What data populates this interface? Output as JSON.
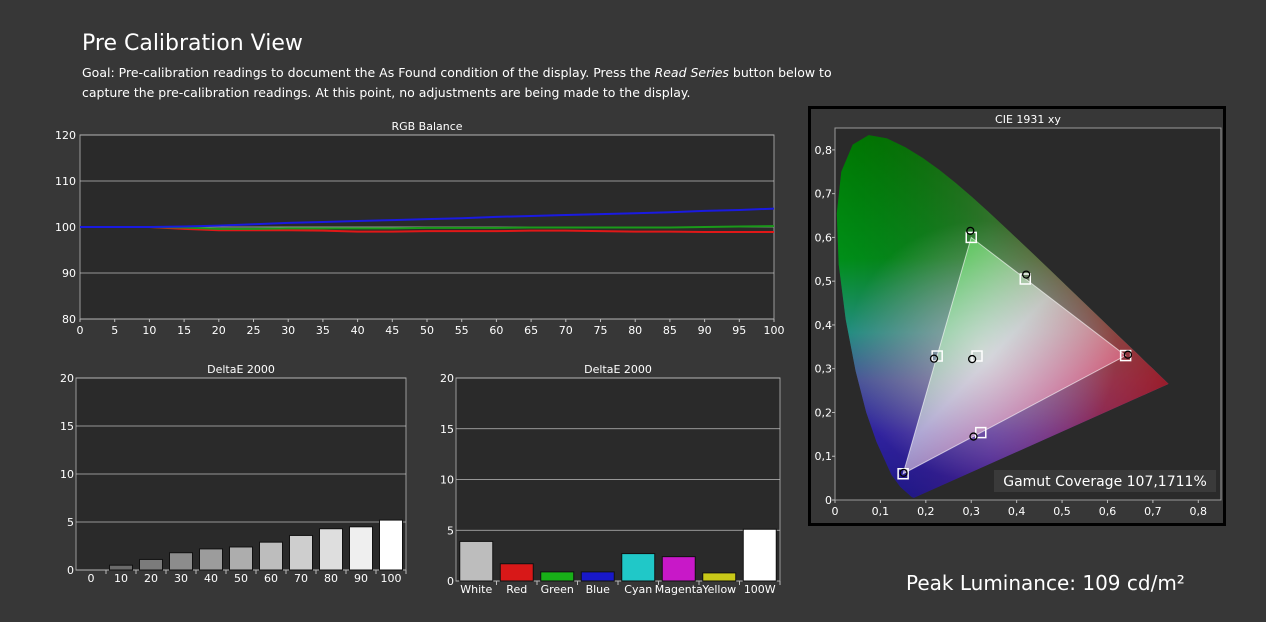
{
  "header": {
    "title": "Pre Calibration View",
    "goal_part1": "Goal: Pre-calibration readings to document the As Found condition of the display. Press the ",
    "goal_em": "Read Series",
    "goal_part2": " button below to capture the pre-calibration readings. At this point, no adjustments are being made to the display."
  },
  "peak_luminance": "Peak Luminance: 109 cd/m²",
  "colors": {
    "background": "#373737",
    "plot_bg": "#2a2a2a",
    "grid": "#bdbdbd",
    "red": "#e01818",
    "green": "#1a9a1a",
    "blue": "#1a1ae0"
  },
  "chart_data": [
    {
      "id": "rgb_balance",
      "type": "line",
      "title": "RGB Balance",
      "x": [
        0,
        5,
        10,
        15,
        20,
        25,
        30,
        35,
        40,
        45,
        50,
        55,
        60,
        65,
        70,
        75,
        80,
        85,
        90,
        95,
        100
      ],
      "x_ticks": [
        "0",
        "5",
        "10",
        "15",
        "20",
        "25",
        "30",
        "35",
        "40",
        "45",
        "50",
        "55",
        "60",
        "65",
        "70",
        "75",
        "80",
        "85",
        "90",
        "95",
        "100"
      ],
      "y_ticks": [
        "80",
        "90",
        "100",
        "110",
        "120"
      ],
      "ylim": [
        80,
        120
      ],
      "xlim": [
        0,
        100
      ],
      "grid": true,
      "series": [
        {
          "color": "#e01818",
          "values": [
            100,
            100,
            100,
            99.6,
            99.3,
            99.3,
            99.3,
            99.2,
            99.0,
            99.0,
            99.1,
            99.1,
            99.1,
            99.2,
            99.2,
            99.1,
            99.0,
            99.0,
            98.9,
            98.9,
            98.9
          ]
        },
        {
          "color": "#1a9a1a",
          "values": [
            100,
            100,
            100,
            99.9,
            99.6,
            99.6,
            99.7,
            99.7,
            99.7,
            99.7,
            99.8,
            99.8,
            99.8,
            99.9,
            99.9,
            99.9,
            99.9,
            99.9,
            100.0,
            100.1,
            100.2
          ]
        },
        {
          "color": "#1a1ae0",
          "values": [
            100,
            100,
            100,
            100.1,
            100.3,
            100.6,
            100.9,
            101.1,
            101.3,
            101.5,
            101.7,
            101.9,
            102.2,
            102.4,
            102.6,
            102.8,
            103.0,
            103.2,
            103.5,
            103.7,
            104.0
          ]
        }
      ]
    },
    {
      "id": "deltae_grayscale",
      "type": "bar",
      "title": "DeltaE 2000",
      "categories": [
        "0",
        "10",
        "20",
        "30",
        "40",
        "50",
        "60",
        "70",
        "80",
        "90",
        "100"
      ],
      "values": [
        0,
        0.5,
        1.1,
        1.8,
        2.2,
        2.4,
        2.9,
        3.6,
        4.3,
        4.5,
        5.2
      ],
      "y_ticks": [
        "0",
        "5",
        "10",
        "15",
        "20"
      ],
      "ylim": [
        0,
        20
      ],
      "grid": true
    },
    {
      "id": "deltae_colors",
      "type": "bar",
      "title": "DeltaE 2000",
      "categories": [
        "White",
        "Red",
        "Green",
        "Blue",
        "Cyan",
        "Magenta",
        "Yellow",
        "100W"
      ],
      "values": [
        3.9,
        1.7,
        0.9,
        0.9,
        2.7,
        2.4,
        0.8,
        5.1
      ],
      "bar_colors": [
        "#bdbdbd",
        "#d81818",
        "#18b018",
        "#1818c8",
        "#20c8c8",
        "#c818c8",
        "#c8c818",
        "#ffffff"
      ],
      "y_ticks": [
        "0",
        "5",
        "10",
        "15",
        "20"
      ],
      "ylim": [
        0,
        20
      ],
      "grid": true
    },
    {
      "id": "cie_1931",
      "type": "scatter",
      "title": "CIE 1931 xy",
      "x_ticks": [
        "0",
        "0,1",
        "0,2",
        "0,3",
        "0,4",
        "0,5",
        "0,6",
        "0,7",
        "0,8"
      ],
      "y_ticks": [
        "0",
        "0,1",
        "0,2",
        "0,3",
        "0,4",
        "0,5",
        "0,6",
        "0,7",
        "0,8"
      ],
      "xlim": [
        0,
        0.85
      ],
      "ylim": [
        0,
        0.85
      ],
      "gamut_coverage_label": "Gamut Coverage 107,1711%",
      "targets": [
        {
          "name": "Red",
          "x": 0.64,
          "y": 0.33
        },
        {
          "name": "Green",
          "x": 0.3,
          "y": 0.6
        },
        {
          "name": "Blue",
          "x": 0.15,
          "y": 0.06
        },
        {
          "name": "White",
          "x": 0.3127,
          "y": 0.329
        },
        {
          "name": "Cyan",
          "x": 0.225,
          "y": 0.329
        },
        {
          "name": "Magenta",
          "x": 0.321,
          "y": 0.154
        },
        {
          "name": "Yellow",
          "x": 0.419,
          "y": 0.505
        }
      ],
      "measured": [
        {
          "name": "Red",
          "x": 0.645,
          "y": 0.332
        },
        {
          "name": "Green",
          "x": 0.298,
          "y": 0.615
        },
        {
          "name": "Blue",
          "x": 0.151,
          "y": 0.062
        },
        {
          "name": "White",
          "x": 0.302,
          "y": 0.322
        },
        {
          "name": "Cyan",
          "x": 0.218,
          "y": 0.323
        },
        {
          "name": "Magenta",
          "x": 0.305,
          "y": 0.145
        },
        {
          "name": "Yellow",
          "x": 0.421,
          "y": 0.515
        }
      ]
    }
  ]
}
